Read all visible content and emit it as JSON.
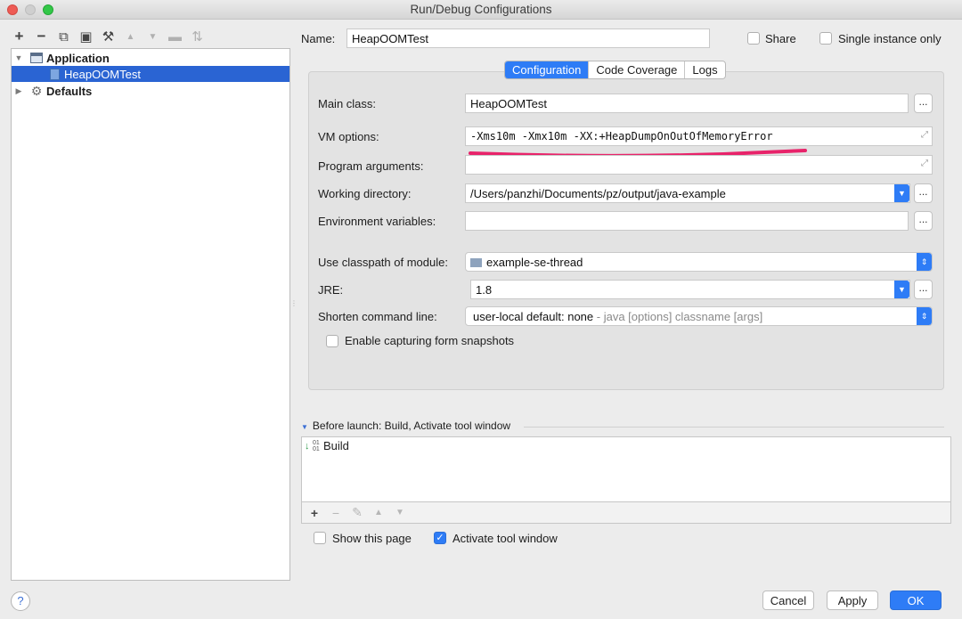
{
  "window": {
    "title": "Run/Debug Configurations"
  },
  "toolbar": {
    "items": [
      {
        "icon": "plus-icon",
        "glyph": "+"
      },
      {
        "icon": "minus-icon",
        "glyph": "−"
      },
      {
        "icon": "copy-icon",
        "glyph": "⧉"
      },
      {
        "icon": "save-icon",
        "glyph": "▣"
      },
      {
        "icon": "wrench-icon",
        "glyph": "⚒"
      },
      {
        "icon": "move-up-icon",
        "glyph": "▲"
      },
      {
        "icon": "move-down-icon",
        "glyph": "▼"
      },
      {
        "icon": "folder-icon",
        "glyph": "▬"
      },
      {
        "icon": "sort-icon",
        "glyph": "⇅"
      }
    ]
  },
  "tree": {
    "application_label": "Application",
    "selected_item": "HeapOOMTest",
    "defaults_label": "Defaults"
  },
  "header": {
    "name_label": "Name:",
    "name_value": "HeapOOMTest",
    "share_label": "Share",
    "single_instance_label": "Single instance only"
  },
  "tabs": [
    "Configuration",
    "Code Coverage",
    "Logs"
  ],
  "form": {
    "main_class_label": "Main class:",
    "main_class_value": "HeapOOMTest",
    "vm_options_label": "VM options:",
    "vm_options_value": "-Xms10m -Xmx10m -XX:+HeapDumpOnOutOfMemoryError",
    "program_args_label": "Program arguments:",
    "program_args_value": "",
    "working_dir_label": "Working directory:",
    "working_dir_value": "/Users/panzhi/Documents/pz/output/java-example",
    "env_vars_label": "Environment variables:",
    "env_vars_value": "",
    "classpath_label": "Use classpath of module:",
    "classpath_value": "example-se-thread",
    "jre_label": "JRE:",
    "jre_value": "1.8",
    "shorten_label": "Shorten command line:",
    "shorten_value": "user-local default: none",
    "shorten_hint": " - java [options] classname [args]",
    "snapshots_label": "Enable capturing form snapshots",
    "browse": "..."
  },
  "before_launch": {
    "header": "Before launch: Build, Activate tool window",
    "items": [
      "Build"
    ]
  },
  "options": {
    "show_page_label": "Show this page",
    "activate_tool_label": "Activate tool window"
  },
  "buttons": {
    "cancel": "Cancel",
    "apply": "Apply",
    "ok": "OK",
    "help": "?"
  },
  "colors": {
    "accent": "#2e7cf6",
    "selection": "#2a64d3",
    "annotation": "#e8236a"
  }
}
